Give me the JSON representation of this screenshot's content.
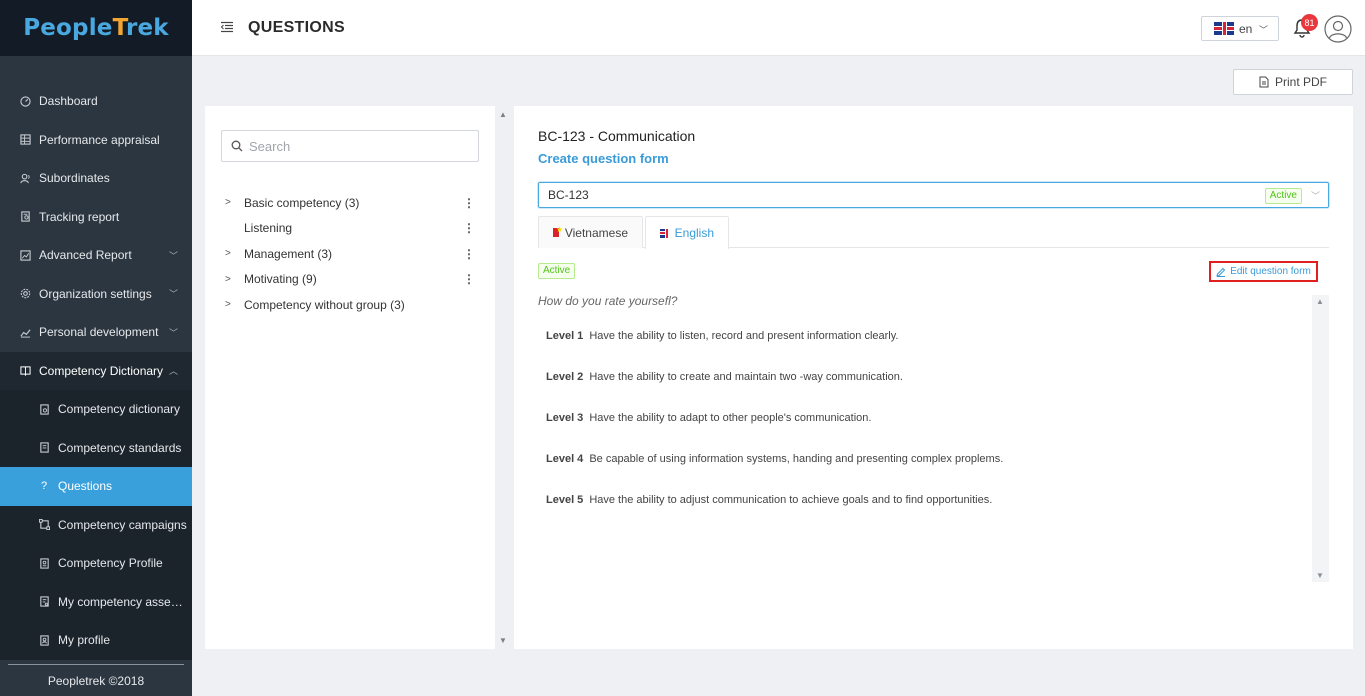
{
  "app": {
    "logo": "PeopleTrek",
    "logo_pre": "People",
    "logo_cross": "T",
    "logo_post": "rek",
    "footer": "Peopletrek ©2018"
  },
  "header": {
    "title": "QUESTIONS",
    "language": "en",
    "notifications_count": "81"
  },
  "sidebar": {
    "items": [
      {
        "label": "Dashboard",
        "icon": "dashboard-icon"
      },
      {
        "label": "Performance appraisal",
        "icon": "table-icon"
      },
      {
        "label": "Subordinates",
        "icon": "users-icon"
      },
      {
        "label": "Tracking report",
        "icon": "report-icon"
      },
      {
        "label": "Advanced Report",
        "icon": "chart-icon"
      },
      {
        "label": "Organization settings",
        "icon": "gear-icon"
      },
      {
        "label": "Personal development",
        "icon": "line-chart-icon"
      },
      {
        "label": "Competency Dictionary",
        "icon": "book-icon"
      }
    ],
    "sub_items": [
      {
        "label": "Competency dictionary"
      },
      {
        "label": "Competency standards"
      },
      {
        "label": "Questions"
      },
      {
        "label": "Competency campaigns"
      },
      {
        "label": "Competency Profile"
      },
      {
        "label": "My competency asse…"
      },
      {
        "label": "My profile"
      }
    ]
  },
  "toolbar": {
    "print_label": "Print PDF"
  },
  "left_panel": {
    "search_placeholder": "Search",
    "tree": [
      {
        "label": "Basic competency (3)",
        "expandable": true
      },
      {
        "label": "Listening",
        "expandable": false
      },
      {
        "label": "Management (3)",
        "expandable": true
      },
      {
        "label": "Motivating (9)",
        "expandable": true
      },
      {
        "label": "Competency without group (3)",
        "expandable": true
      }
    ]
  },
  "right_panel": {
    "title": "BC-123 - Communication",
    "subtitle": "Create question form",
    "select_value": "BC-123",
    "select_status": "Active",
    "tabs": [
      {
        "label": "Vietnamese"
      },
      {
        "label": "English"
      }
    ],
    "status": "Active",
    "edit_label": "Edit question form",
    "question": "How do you rate yoursefl?",
    "levels": [
      {
        "level": "Level 1",
        "text": "Have the ability to listen, record and present information clearly."
      },
      {
        "level": "Level 2",
        "text": "Have the ability to create and maintain two -way communication."
      },
      {
        "level": "Level 3",
        "text": "Have the ability to adapt to other people's communication."
      },
      {
        "level": "Level 4",
        "text": "Be capable of using information systems, handing and presenting complex proplems."
      },
      {
        "level": "Level 5",
        "text": "Have the ability to adjust communication to achieve goals and to find opportunities."
      }
    ]
  },
  "colors": {
    "accent": "#3a9bd8",
    "sidebar_bg": "#2c3640",
    "active_bg": "#3aa0dc",
    "highlight": "#e01f1f"
  }
}
